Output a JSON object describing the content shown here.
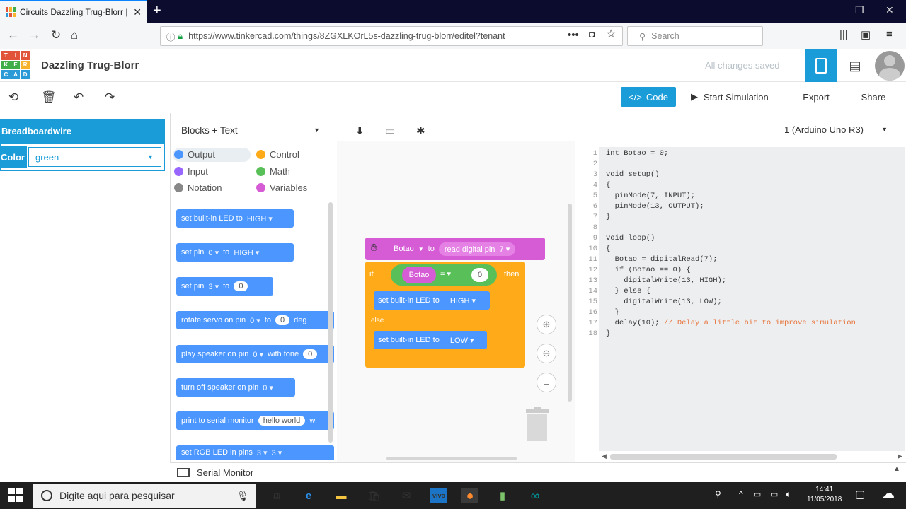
{
  "browser": {
    "tab_title": "Circuits Dazzling Trug-Blorr | Ti",
    "url": "https://www.tinkercad.com/things/8ZGXLKOrL5s-dazzling-trug-blorr/editel?tenant",
    "search_placeholder": "Search"
  },
  "app": {
    "logo_letters": [
      "TIN",
      "KER",
      "CAD"
    ],
    "project_name": "Dazzling Trug-Blorr",
    "save_status": "All changes saved"
  },
  "toolbar": {
    "code_label": "Code",
    "start_sim_label": "Start Simulation",
    "export_label": "Export",
    "share_label": "Share"
  },
  "inspector": {
    "title": "Breadboardwire",
    "color_label": "Color",
    "color_value": "green"
  },
  "code_panel": {
    "mode": "Blocks + Text",
    "board": "1 (Arduino Uno R3)",
    "categories": [
      {
        "label": "Output",
        "color": "#4c97ff"
      },
      {
        "label": "Control",
        "color": "#ffab19"
      },
      {
        "label": "Input",
        "color": "#9966ff"
      },
      {
        "label": "Math",
        "color": "#59c059"
      },
      {
        "label": "Notation",
        "color": "#888888"
      },
      {
        "label": "Variables",
        "color": "#d65cd6"
      }
    ],
    "palette": [
      {
        "text": "set built-in LED to",
        "opt": "HIGH ▾"
      },
      {
        "text": "set pin",
        "opt": "0 ▾",
        "text2": "to",
        "opt2": "HIGH ▾"
      },
      {
        "text": "set pin",
        "opt": "3 ▾",
        "text2": "to",
        "val": "0"
      },
      {
        "text": "rotate servo on pin",
        "opt": "0 ▾",
        "text2": "to",
        "val": "0",
        "text3": "deg"
      },
      {
        "text": "play speaker on pin",
        "opt": "0 ▾",
        "text2": "with tone",
        "val": "0"
      },
      {
        "text": "turn off speaker on pin",
        "opt": "0 ▾"
      },
      {
        "text": "print to serial monitor",
        "val": "hello world",
        "text2": "wi"
      },
      {
        "text": "set RGB LED in pins",
        "opt": "3 ▾",
        "opt2": "3 ▾"
      }
    ],
    "workspace": {
      "var_name": "Botao",
      "to_label": "to",
      "read_label": "read digital pin",
      "read_pin": "7 ▾",
      "if_label": "if",
      "cmp_var": "Botao",
      "cmp_op": "= ▾",
      "cmp_val": "0",
      "then_label": "then",
      "high_block": "set built-in LED to",
      "high_opt": "HIGH ▾",
      "else_label": "else",
      "low_block": "set built-in LED to",
      "low_opt": "LOW ▾",
      "zoom_reset": "="
    },
    "serial_label": "Serial Monitor"
  },
  "code_lines": [
    "int Botao = 0;",
    "",
    "void setup()",
    "{",
    "  pinMode(7, INPUT);",
    "  pinMode(13, OUTPUT);",
    "}",
    "",
    "void loop()",
    "{",
    "  Botao = digitalRead(7);",
    "  if (Botao == 0) {",
    "    digitalWrite(13, HIGH);",
    "  } else {",
    "    digitalWrite(13, LOW);",
    "  }",
    "  delay(10); // Delay a little bit to improve simulation",
    "}"
  ],
  "taskbar": {
    "search_placeholder": "Digite aqui para pesquisar",
    "time": "14:41",
    "date": "11/05/2018"
  }
}
